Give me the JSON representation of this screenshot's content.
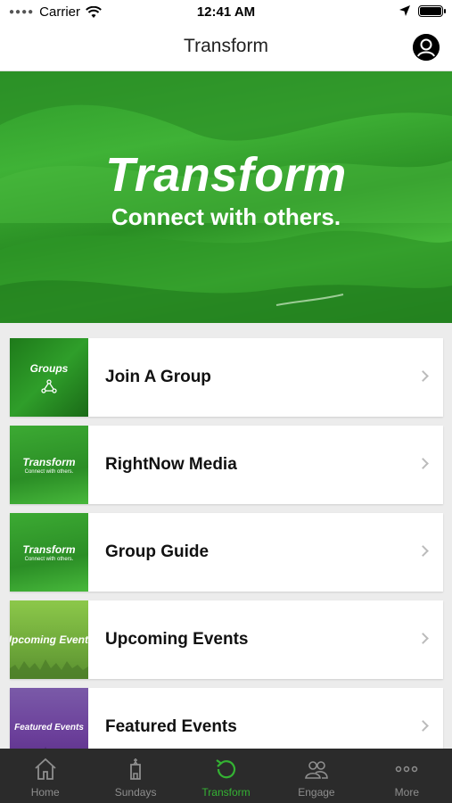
{
  "status_bar": {
    "carrier": "Carrier",
    "time": "12:41 AM"
  },
  "nav": {
    "title": "Transform"
  },
  "hero": {
    "title": "Transform",
    "subtitle": "Connect with others."
  },
  "list": [
    {
      "label": "Join A Group",
      "thumb_title": "Groups",
      "thumb_sub": ""
    },
    {
      "label": "RightNow Media",
      "thumb_title": "Transform",
      "thumb_sub": "Connect with others."
    },
    {
      "label": "Group Guide",
      "thumb_title": "Transform",
      "thumb_sub": "Connect with others."
    },
    {
      "label": "Upcoming Events",
      "thumb_title": "Upcoming Events",
      "thumb_sub": ""
    },
    {
      "label": "Featured Events",
      "thumb_title": "Featured Events",
      "thumb_sub": ""
    }
  ],
  "tabs": [
    {
      "label": "Home",
      "icon": "home-icon"
    },
    {
      "label": "Sundays",
      "icon": "sundays-icon"
    },
    {
      "label": "Transform",
      "icon": "transform-icon",
      "active": true
    },
    {
      "label": "Engage",
      "icon": "engage-icon"
    },
    {
      "label": "More",
      "icon": "more-icon"
    }
  ],
  "colors": {
    "accent": "#34b233",
    "tab_bar_bg": "#2b2b2b",
    "hero_green": "#3fb236"
  }
}
